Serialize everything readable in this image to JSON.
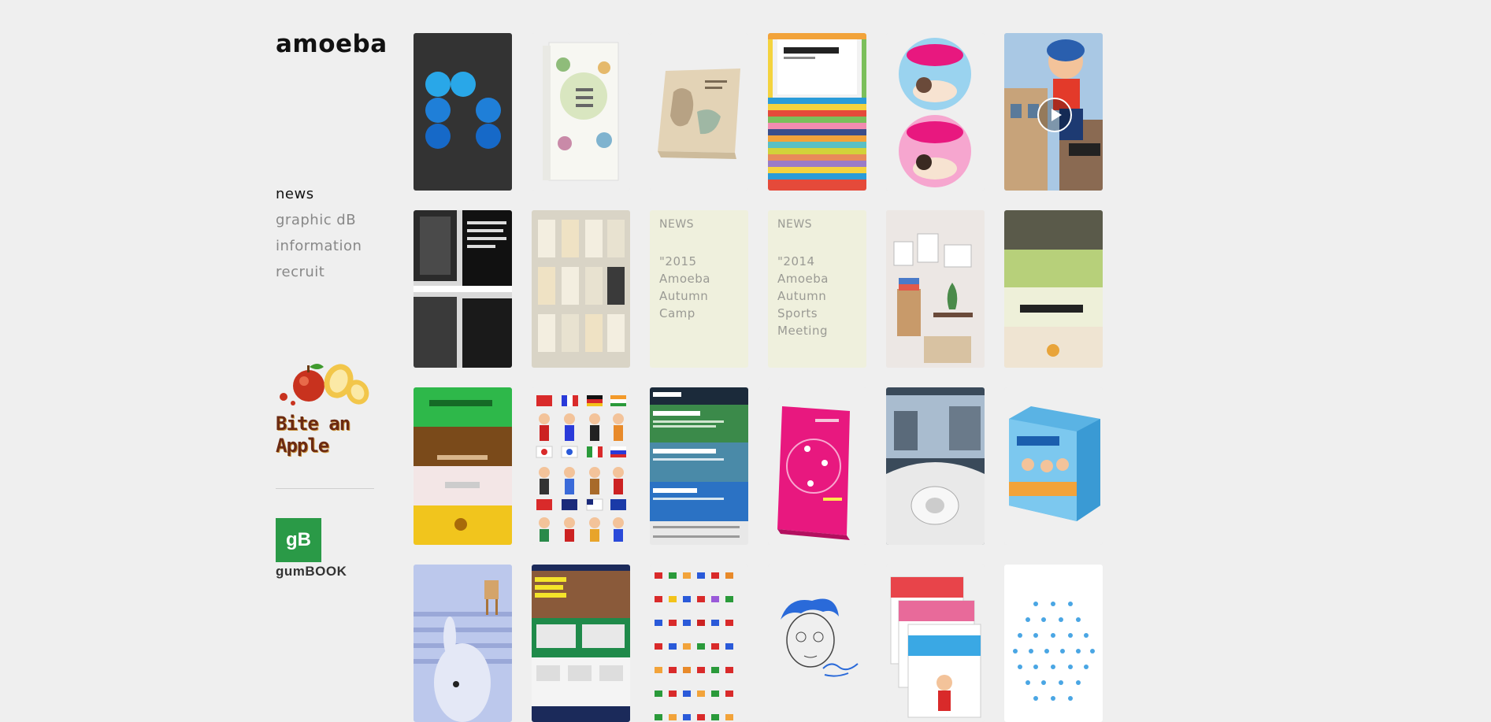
{
  "brand": {
    "logo_text": "amoeba"
  },
  "nav": {
    "items": [
      {
        "label": "news",
        "active": true
      },
      {
        "label": "graphic  dB",
        "active": false
      },
      {
        "label": "information",
        "active": false
      },
      {
        "label": "recruit",
        "active": false
      }
    ]
  },
  "sidebar": {
    "apple_banner_text": "Bite an Apple",
    "gumbook_badge": "gB",
    "gumbook_text": "gumBOOK"
  },
  "tiles": {
    "news1": {
      "tag": "NEWS",
      "headline": "\"2015 Amoeba Autumn Camp"
    },
    "news2": {
      "tag": "NEWS",
      "headline": "\"2014 Amoeba Autumn Sports Meeting"
    }
  },
  "colors": {
    "background": "#efefef",
    "news_tile_bg": "#eff0dd",
    "gumbook_green": "#2a9a47",
    "accent_pink": "#e8187f"
  }
}
